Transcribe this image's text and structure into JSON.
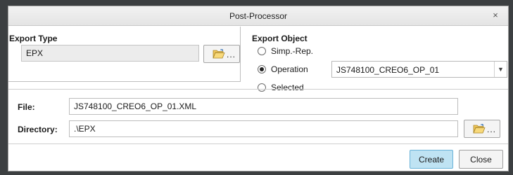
{
  "dialog": {
    "title": "Post-Processor",
    "close_glyph": "×"
  },
  "export_type": {
    "label": "Export Type",
    "value": "EPX",
    "browse_label": "...",
    "browse_icon": "folder-open-icon"
  },
  "export_object": {
    "label": "Export Object",
    "options": [
      {
        "label": "Simp.-Rep.",
        "checked": false
      },
      {
        "label": "Operation",
        "checked": true
      },
      {
        "label": "Selected",
        "checked": false
      }
    ],
    "operation_value": "JS748100_CREO6_OP_01"
  },
  "file": {
    "label": "File:",
    "value": "JS748100_CREO6_OP_01.XML"
  },
  "directory": {
    "label": "Directory:",
    "value": ".\\EPX",
    "browse_label": "..."
  },
  "buttons": {
    "create": "Create",
    "close": "Close"
  },
  "colors": {
    "primary_button": "#bfe3f3",
    "background": "#3c3f41"
  }
}
